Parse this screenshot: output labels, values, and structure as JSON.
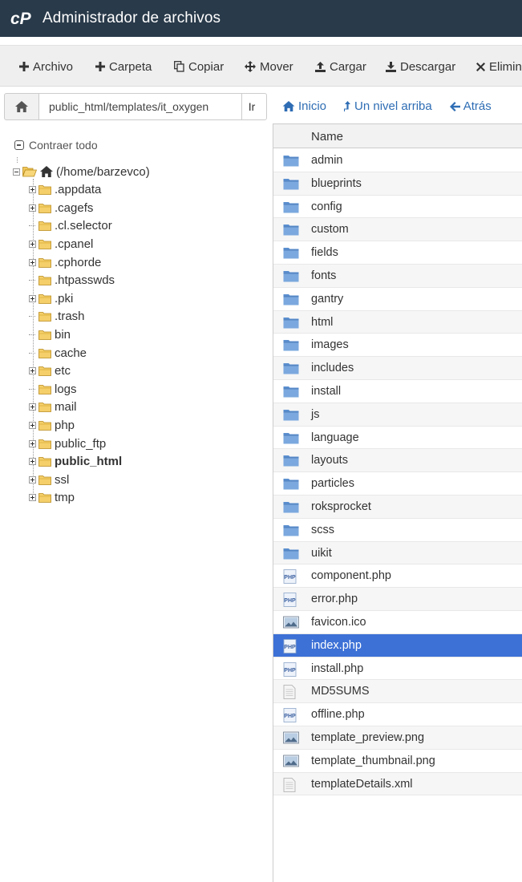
{
  "header": {
    "title": "Administrador de archivos"
  },
  "toolbar": {
    "buttons": [
      {
        "label": "Archivo",
        "icon": "plus-icon"
      },
      {
        "label": "Carpeta",
        "icon": "plus-icon"
      },
      {
        "label": "Copiar",
        "icon": "copy-icon"
      },
      {
        "label": "Mover",
        "icon": "move-icon"
      },
      {
        "label": "Cargar",
        "icon": "upload-icon"
      },
      {
        "label": "Descargar",
        "icon": "download-icon"
      },
      {
        "label": "Elimin",
        "icon": "close-icon"
      }
    ]
  },
  "pathbar": {
    "path": "public_html/templates/it_oxygen",
    "go_label": "Ir"
  },
  "nav": {
    "home": "Inicio",
    "up": "Un nivel arriba",
    "back": "Atrás"
  },
  "tree": {
    "collapse_all": "Contraer todo",
    "root": "(/home/barzevco)",
    "items": [
      {
        "label": ".appdata",
        "expandable": true
      },
      {
        "label": ".cagefs",
        "expandable": true
      },
      {
        "label": ".cl.selector",
        "expandable": false
      },
      {
        "label": ".cpanel",
        "expandable": true
      },
      {
        "label": ".cphorde",
        "expandable": true
      },
      {
        "label": ".htpasswds",
        "expandable": false
      },
      {
        "label": ".pki",
        "expandable": true
      },
      {
        "label": ".trash",
        "expandable": false
      },
      {
        "label": "bin",
        "expandable": false
      },
      {
        "label": "cache",
        "expandable": false
      },
      {
        "label": "etc",
        "expandable": true
      },
      {
        "label": "logs",
        "expandable": false
      },
      {
        "label": "mail",
        "expandable": true
      },
      {
        "label": "php",
        "expandable": true
      },
      {
        "label": "public_ftp",
        "expandable": true
      },
      {
        "label": "public_html",
        "expandable": true,
        "bold": true
      },
      {
        "label": "ssl",
        "expandable": true
      },
      {
        "label": "tmp",
        "expandable": true
      }
    ]
  },
  "files": {
    "column_name": "Name",
    "rows": [
      {
        "name": "admin",
        "type": "folder"
      },
      {
        "name": "blueprints",
        "type": "folder"
      },
      {
        "name": "config",
        "type": "folder"
      },
      {
        "name": "custom",
        "type": "folder"
      },
      {
        "name": "fields",
        "type": "folder"
      },
      {
        "name": "fonts",
        "type": "folder"
      },
      {
        "name": "gantry",
        "type": "folder"
      },
      {
        "name": "html",
        "type": "folder"
      },
      {
        "name": "images",
        "type": "folder"
      },
      {
        "name": "includes",
        "type": "folder"
      },
      {
        "name": "install",
        "type": "folder"
      },
      {
        "name": "js",
        "type": "folder"
      },
      {
        "name": "language",
        "type": "folder"
      },
      {
        "name": "layouts",
        "type": "folder"
      },
      {
        "name": "particles",
        "type": "folder"
      },
      {
        "name": "roksprocket",
        "type": "folder"
      },
      {
        "name": "scss",
        "type": "folder"
      },
      {
        "name": "uikit",
        "type": "folder"
      },
      {
        "name": "component.php",
        "type": "php"
      },
      {
        "name": "error.php",
        "type": "php"
      },
      {
        "name": "favicon.ico",
        "type": "image"
      },
      {
        "name": "index.php",
        "type": "php",
        "selected": true
      },
      {
        "name": "install.php",
        "type": "php"
      },
      {
        "name": "MD5SUMS",
        "type": "text"
      },
      {
        "name": "offline.php",
        "type": "php"
      },
      {
        "name": "template_preview.png",
        "type": "image"
      },
      {
        "name": "template_thumbnail.png",
        "type": "image"
      },
      {
        "name": "templateDetails.xml",
        "type": "text"
      }
    ]
  },
  "colors": {
    "header_bg": "#293a4a",
    "link": "#2e6db4",
    "selected_row": "#3d71d6",
    "folder_blue": "#5b8fcf"
  }
}
